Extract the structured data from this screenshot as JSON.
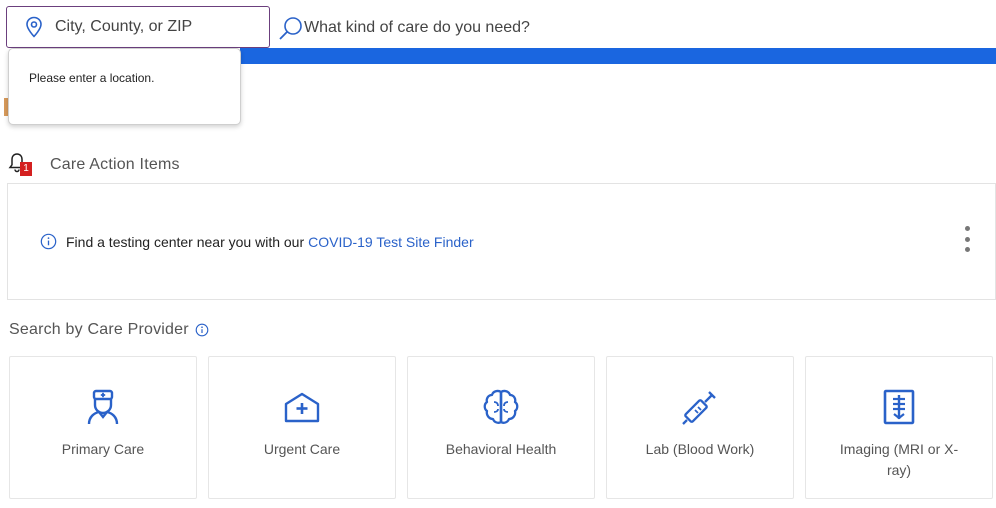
{
  "search": {
    "location_placeholder": "City, County, or ZIP",
    "care_placeholder": "What kind of care do you need?",
    "location_error": "Please enter a location."
  },
  "care_actions": {
    "title": "Care Action Items",
    "badge_count": "1",
    "item_text": "Find a testing center near you with our",
    "item_link": "COVID-19 Test Site Finder"
  },
  "providers": {
    "title": "Search by Care Provider",
    "tiles": [
      {
        "label": "Primary Care",
        "icon": "nurse-icon"
      },
      {
        "label": "Urgent Care",
        "icon": "urgent-care-icon"
      },
      {
        "label": "Behavioral Health",
        "icon": "brain-icon"
      },
      {
        "label": "Lab (Blood Work)",
        "icon": "syringe-icon"
      },
      {
        "label": "Imaging (MRI or X-ray)",
        "icon": "xray-icon"
      }
    ]
  },
  "colors": {
    "accent_blue": "#1a66e0",
    "link_blue": "#2a62c9",
    "badge_red": "#d42020",
    "focus_border": "#6b3f7d"
  }
}
